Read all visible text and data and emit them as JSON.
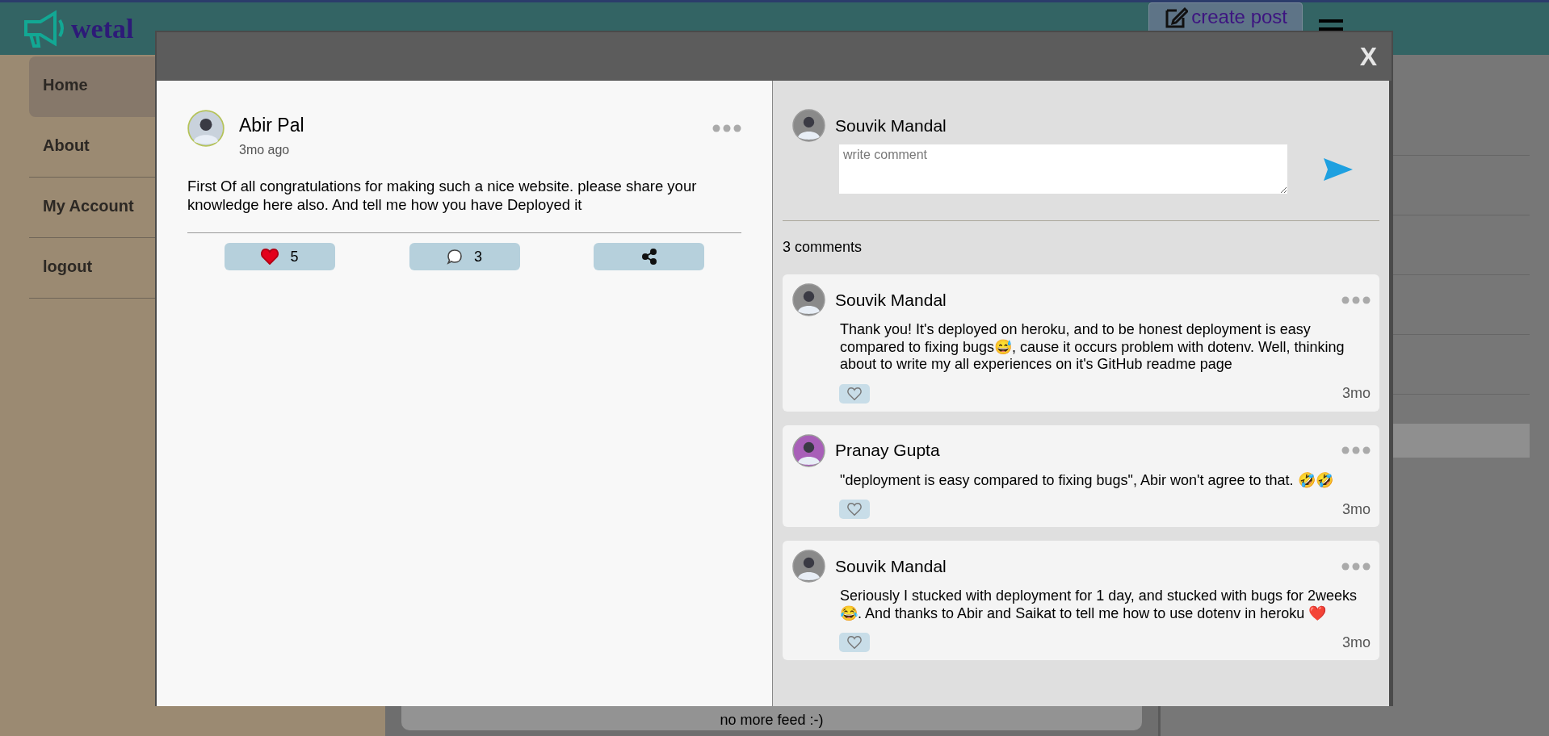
{
  "header": {
    "logo": "wetal",
    "create_button": "create post"
  },
  "sidebar": {
    "items": [
      {
        "label": "Home",
        "selected": true
      },
      {
        "label": "About",
        "selected": false
      },
      {
        "label": "My Account",
        "selected": false
      },
      {
        "label": "logout",
        "selected": false
      }
    ]
  },
  "feed": {
    "end_message": "no more feed :-)"
  },
  "modal": {
    "close": "X",
    "post": {
      "author": "Abir Pal",
      "time": "3mo ago",
      "text": "First Of all congratulations for making such a nice website. please share your knowledge here also. And tell me how you have Deployed it",
      "liked": true,
      "likes": "5",
      "comments": "3"
    },
    "composer": {
      "author": "Souvik Mandal",
      "placeholder": "write comment"
    },
    "comment_count": "3 comments",
    "comments": [
      {
        "author": "Souvik Mandal",
        "color": "#8a8a8a",
        "text": "Thank you! It's deployed on heroku, and to be honest deployment is easy compared to fixing bugs😅, cause it occurs problem with dotenv. Well, thinking about to write my all experiences on it's GitHub readme page",
        "liked": false,
        "time": "3mo"
      },
      {
        "author": "Pranay Gupta",
        "color": "#a85fb8",
        "text": "\"deployment is easy compared to fixing bugs\", Abir won't agree to that. 🤣🤣",
        "liked": false,
        "time": "3mo"
      },
      {
        "author": "Souvik Mandal",
        "color": "#8a8a8a",
        "text": "Seriously I stucked with deployment for 1 day, and stucked with bugs for 2weeks 😂. And thanks to Abir and Saikat to tell me how to use dotenv in heroku ❤️",
        "liked": false,
        "time": "3mo"
      }
    ]
  }
}
